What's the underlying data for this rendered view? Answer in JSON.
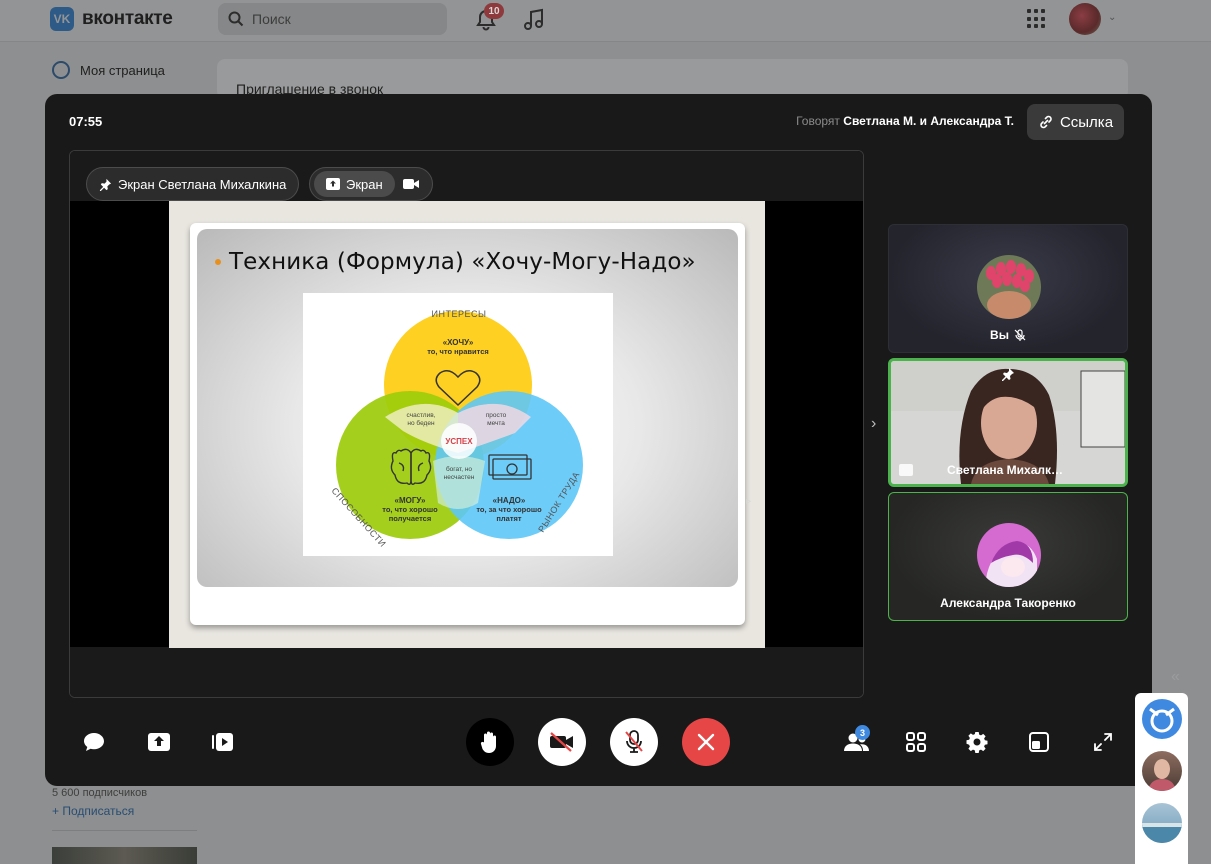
{
  "vk": {
    "logo": "вконтакте",
    "search_placeholder": "Поиск",
    "notifications_count": "10",
    "sidebar_item": "Моя страница",
    "invite_text": "Приглашение в звонок",
    "subscribers": "5 600 подписчиков",
    "subscribe": "+ Подписаться"
  },
  "call": {
    "timer": "07:55",
    "speaking_prefix": "Говорят",
    "speaking_names": "Светлана М. и Александра Т.",
    "link_label": "Ссылка",
    "pinned_label": "Экран Светлана Михалкина",
    "source_active": "Экран",
    "participants_count": "3",
    "tiles": [
      {
        "name": "Вы",
        "muted": true
      },
      {
        "name": "Светлана Михалк…",
        "pinned": true,
        "sharing": true
      },
      {
        "name": "Александра Такоренко"
      }
    ]
  },
  "slide": {
    "title": "Техника (Формула) «Хочу-Могу-Надо»",
    "venn": {
      "top_label": "ИНТЕРЕСЫ",
      "left_label": "СПОСОБНОСТИ",
      "right_label": "РЫНОК ТРУДА",
      "want_title": "«ХОЧУ»",
      "want_sub": "то, что нравится",
      "can_title": "«МОГУ»",
      "can_sub1": "то, что хорошо",
      "can_sub2": "получается",
      "need_title": "«НАДО»",
      "need_sub1": "то, за что хорошо",
      "need_sub2": "платят",
      "happy_poor1": "счастлив,",
      "happy_poor2": "но беден",
      "dream1": "просто",
      "dream2": "мечта",
      "rich_unhappy1": "богат, но",
      "rich_unhappy2": "несчастен",
      "success": "УСПЕХ"
    }
  },
  "colors": {
    "yellow": "#fdd022",
    "green": "#9ccc0a",
    "blue": "#5ec6f7",
    "active_border": "#4bb34b",
    "end_call": "#e64646"
  }
}
